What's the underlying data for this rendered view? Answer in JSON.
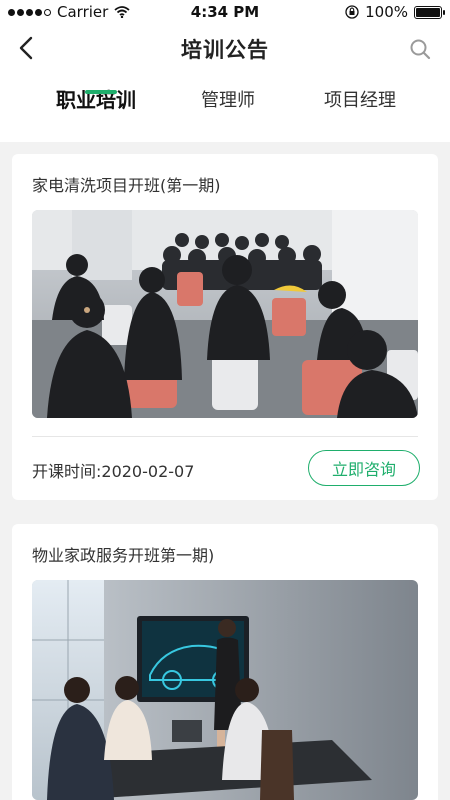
{
  "status_bar": {
    "carrier": "Carrier",
    "time": "4:34 PM",
    "battery": "100%",
    "battery_level": 1.0
  },
  "header": {
    "title": "培训公告",
    "back_icon": "chevron-left-icon",
    "search_icon": "search-icon"
  },
  "tabs": [
    {
      "label": "职业培训",
      "active": true
    },
    {
      "label": "管理师",
      "active": false
    },
    {
      "label": "项目经理",
      "active": false
    }
  ],
  "colors": {
    "accent": "#1fae6c",
    "background": "#f2f2f2",
    "card": "#ffffff"
  },
  "cards": [
    {
      "title": "家电清洗项目开班(第一期)",
      "image": "classroom-training-photo",
      "start_time": "开课时间:2020-02-07",
      "button": "立即咨询"
    },
    {
      "title": "物业家政服务开班第一期)",
      "image": "meeting-presentation-photo"
    }
  ]
}
